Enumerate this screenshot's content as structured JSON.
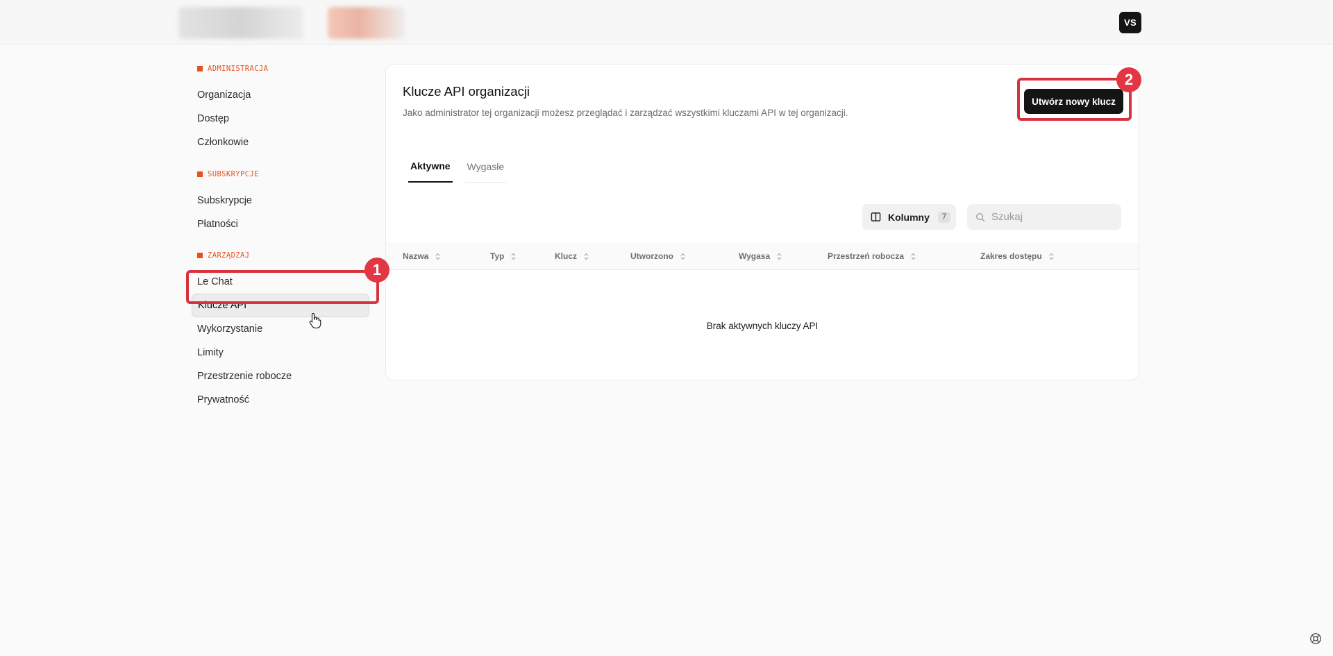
{
  "header": {
    "avatar_initials": "VS"
  },
  "sidebar": {
    "sections": [
      {
        "label": "ADMINISTRACJA",
        "items": [
          "Organizacja",
          "Dostęp",
          "Członkowie"
        ]
      },
      {
        "label": "SUBSKRYPCJE",
        "items": [
          "Subskrypcje",
          "Płatności"
        ]
      },
      {
        "label": "ZARZĄDZAJ",
        "items": [
          "Le Chat",
          "Klucze API",
          "Wykorzystanie",
          "Limity",
          "Przestrzenie robocze",
          "Prywatność"
        ]
      }
    ],
    "active_item": "Klucze API"
  },
  "main": {
    "title": "Klucze API organizacji",
    "description": "Jako administrator tej organizacji możesz przeglądać i zarządzać wszystkimi kluczami API w tej organizacji.",
    "create_button": "Utwórz nowy klucz",
    "tabs": [
      {
        "label": "Aktywne",
        "active": true
      },
      {
        "label": "Wygasłe",
        "active": false
      }
    ],
    "columns_button": {
      "label": "Kolumny",
      "count": "7"
    },
    "search": {
      "placeholder": "Szukaj",
      "value": ""
    },
    "table": {
      "columns": [
        "Nazwa",
        "Typ",
        "Klucz",
        "Utworzono",
        "Wygasa",
        "Przestrzeń robocza",
        "Zakres dostępu"
      ],
      "empty_message": "Brak aktywnych kluczy API"
    }
  },
  "annotations": [
    {
      "number": "1",
      "color": "#d8323f"
    },
    {
      "number": "2",
      "color": "#d8323f"
    }
  ],
  "colors": {
    "accent": "#e8501e",
    "primary_button": "#141414",
    "annotation": "#d8323f"
  }
}
